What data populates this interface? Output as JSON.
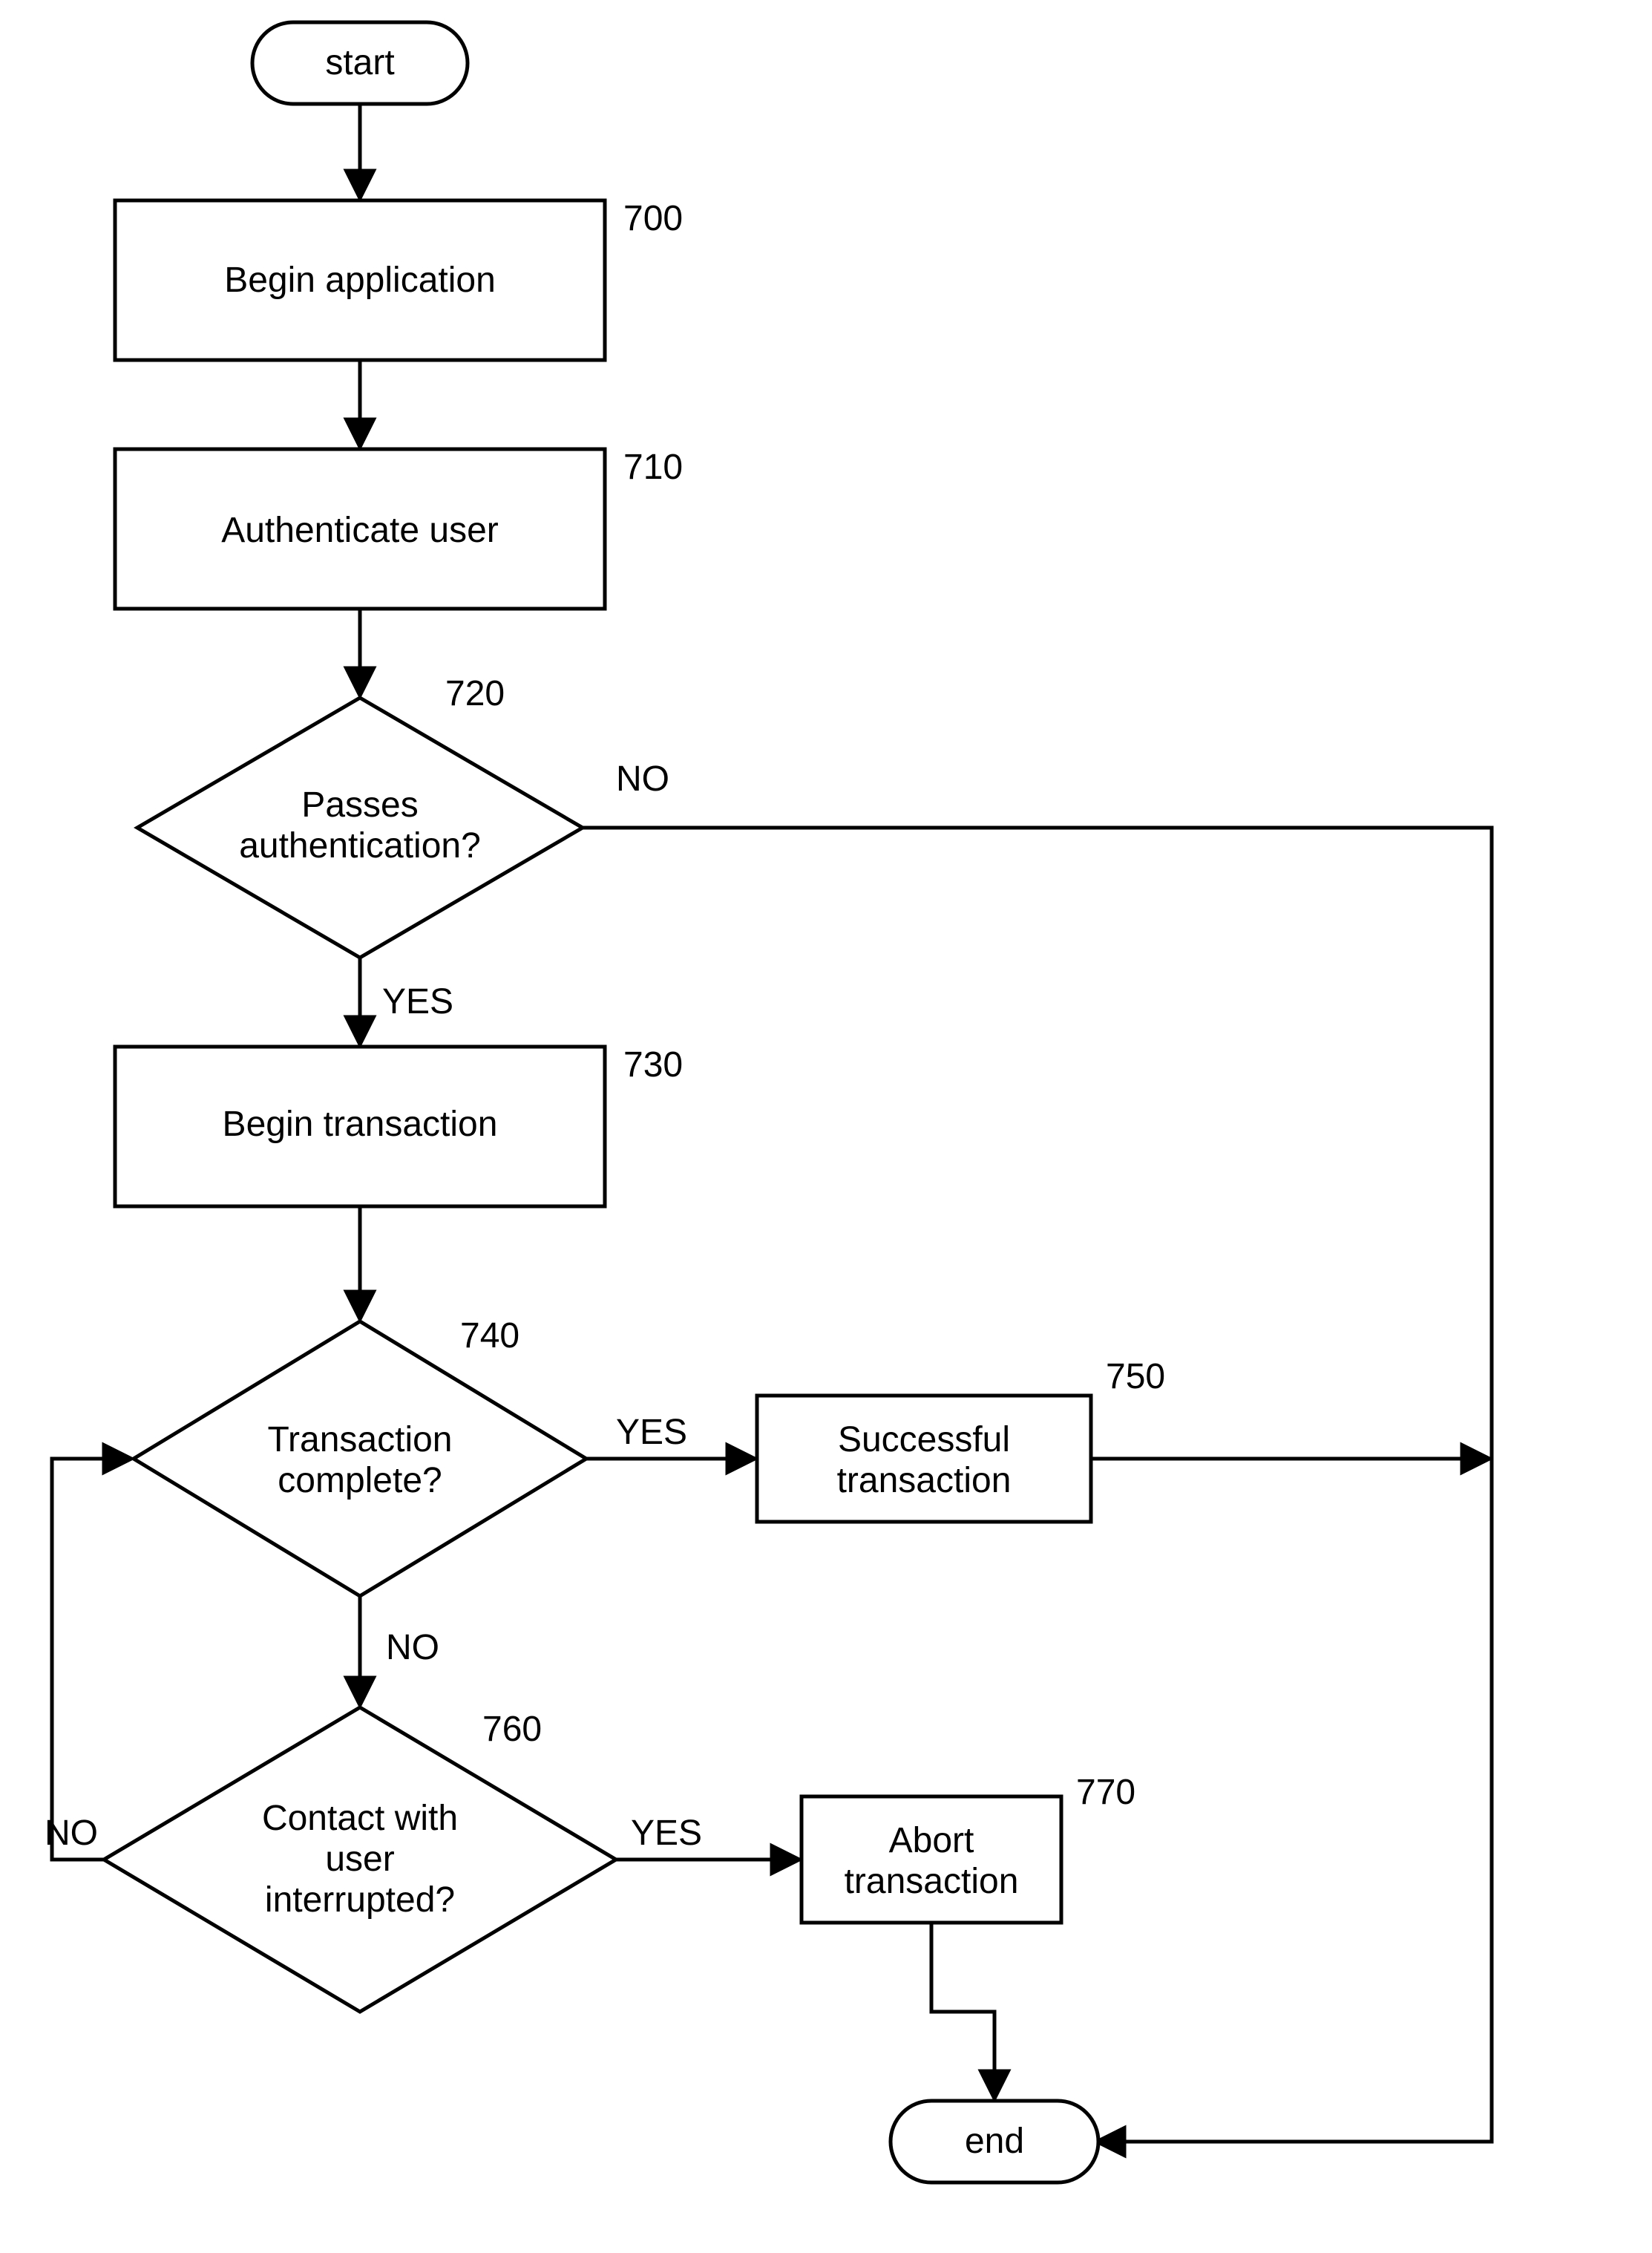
{
  "flowchart": {
    "start": "start",
    "end": "end",
    "nodes": {
      "n700": {
        "label_line1": "Begin application",
        "ref": "700"
      },
      "n710": {
        "label_line1": "Authenticate user",
        "ref": "710"
      },
      "n720": {
        "label_line1": "Passes",
        "label_line2": "authentication?",
        "ref": "720"
      },
      "n730": {
        "label_line1": "Begin transaction",
        "ref": "730"
      },
      "n740": {
        "label_line1": "Transaction",
        "label_line2": "complete?",
        "ref": "740"
      },
      "n750": {
        "label_line1": "Successful",
        "label_line2": "transaction",
        "ref": "750"
      },
      "n760": {
        "label_line1": "Contact with",
        "label_line2": "user",
        "label_line3": "interrupted?",
        "ref": "760"
      },
      "n770": {
        "label_line1": "Abort",
        "label_line2": "transaction",
        "ref": "770"
      }
    },
    "edge_labels": {
      "yes": "YES",
      "no": "NO"
    }
  }
}
